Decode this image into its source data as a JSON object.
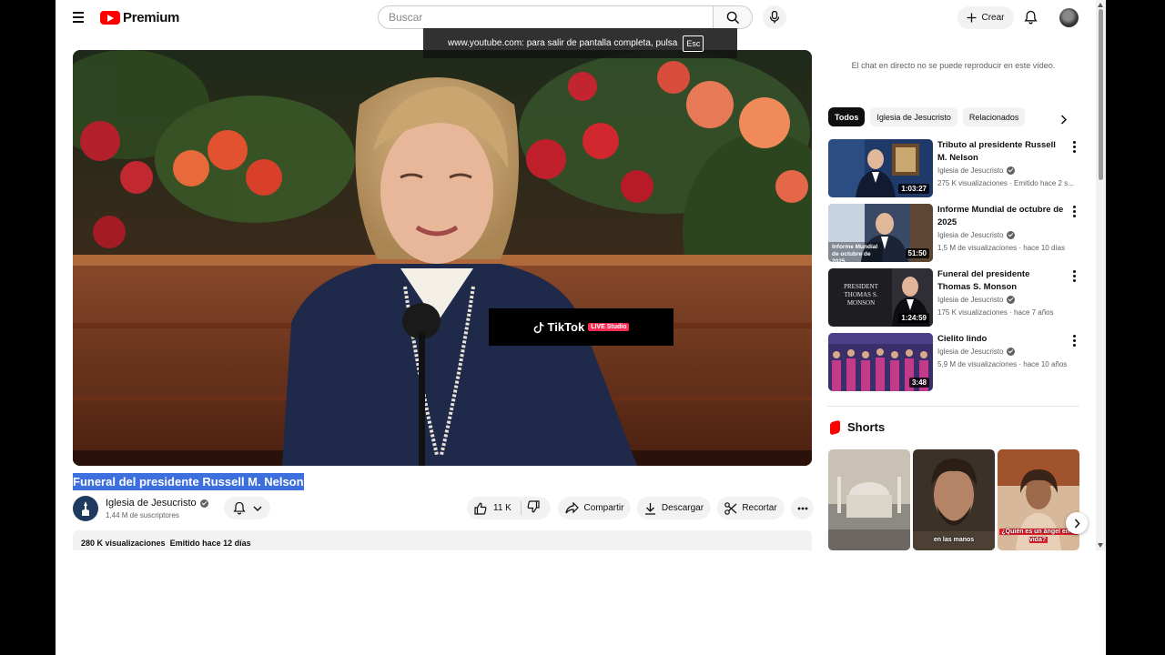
{
  "header": {
    "logo_text": "Premium",
    "search_placeholder": "Buscar",
    "create_label": "Crear"
  },
  "fullscreen_toast": {
    "message": "www.youtube.com: para salir de pantalla completa, pulsa",
    "key": "Esc"
  },
  "player": {
    "overlay_brand": "TikTok",
    "overlay_badge": "LIVE Studio"
  },
  "video": {
    "title": "Funeral del presidente Russell M. Nelson",
    "channel": "Iglesia de Jesucristo",
    "subscribers": "1,44 M de suscriptores",
    "likes": "11 K",
    "share_label": "Compartir",
    "download_label": "Descargar",
    "clip_label": "Recortar",
    "views": "280 K visualizaciones",
    "published": "Emitido hace 12 días"
  },
  "sidebar": {
    "chat_note": "El chat en directo no se puede reproducir en este vídeo.",
    "chips": [
      "Todos",
      "Iglesia de Jesucristo",
      "Relacionados"
    ],
    "recommendations": [
      {
        "title": "Tributo al presidente Russell M. Nelson",
        "channel": "Iglesia de Jesucristo",
        "meta": "275 K visualizaciones · Emitido hace 2 s...",
        "duration": "1:03:27"
      },
      {
        "title": "Informe Mundial de octubre de 2025",
        "channel": "Iglesia de Jesucristo",
        "meta": "1,5 M de visualizaciones · hace 10 días",
        "duration": "51:50",
        "thumb_caption": "Informe Mundial de octubre de 2025"
      },
      {
        "title": "Funeral del presidente Thomas S. Monson",
        "channel": "Iglesia de Jesucristo",
        "meta": "175 K visualizaciones · hace 7 años",
        "duration": "1:24:59",
        "thumb_caption": "PRESIDENT THOMAS S. MONSON"
      },
      {
        "title": "Cielito lindo",
        "channel": "Iglesia de Jesucristo",
        "meta": "5,9 M de visualizaciones · hace 10 años",
        "duration": "3:48"
      }
    ],
    "shorts_title": "Shorts",
    "shorts": [
      {
        "caption": "",
        "color": "#8d8a84"
      },
      {
        "caption": "en las manos",
        "color": "#3b3128"
      },
      {
        "caption": "¿Quién es un ángel en tu vida?",
        "color": "#b46a4a"
      }
    ]
  }
}
